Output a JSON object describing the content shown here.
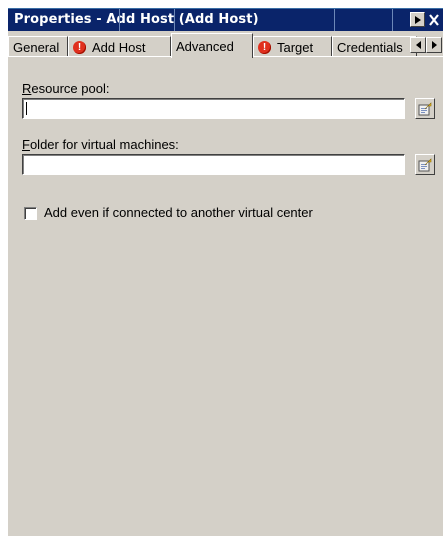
{
  "window": {
    "title": "Properties - Add Host (Add Host)",
    "nav_icon": "arrow-right-icon",
    "close_icon": "close-icon"
  },
  "tabs": [
    {
      "label": "General",
      "warning": false,
      "active": false
    },
    {
      "label": "Add Host",
      "warning": true,
      "active": false
    },
    {
      "label": "Advanced",
      "warning": false,
      "active": true
    },
    {
      "label": "Target",
      "warning": true,
      "active": false
    },
    {
      "label": "Credentials",
      "warning": false,
      "active": false
    }
  ],
  "tab_scroll": {
    "left_icon": "arrow-left-icon",
    "right_icon": "arrow-right-icon"
  },
  "form": {
    "resource_pool": {
      "access_key": "R",
      "label_rest": "esource pool:",
      "value": "",
      "browse_icon": "browse-icon"
    },
    "folder": {
      "access_key": "F",
      "label_rest": "older for virtual machines:",
      "value": "",
      "browse_icon": "browse-icon"
    },
    "add_even_connected": {
      "label": "Add even if connected to another virtual center",
      "checked": false
    }
  },
  "colors": {
    "titlebar": "#0a246a",
    "panel": "#d4d0c8",
    "warning": "#e0301e"
  }
}
